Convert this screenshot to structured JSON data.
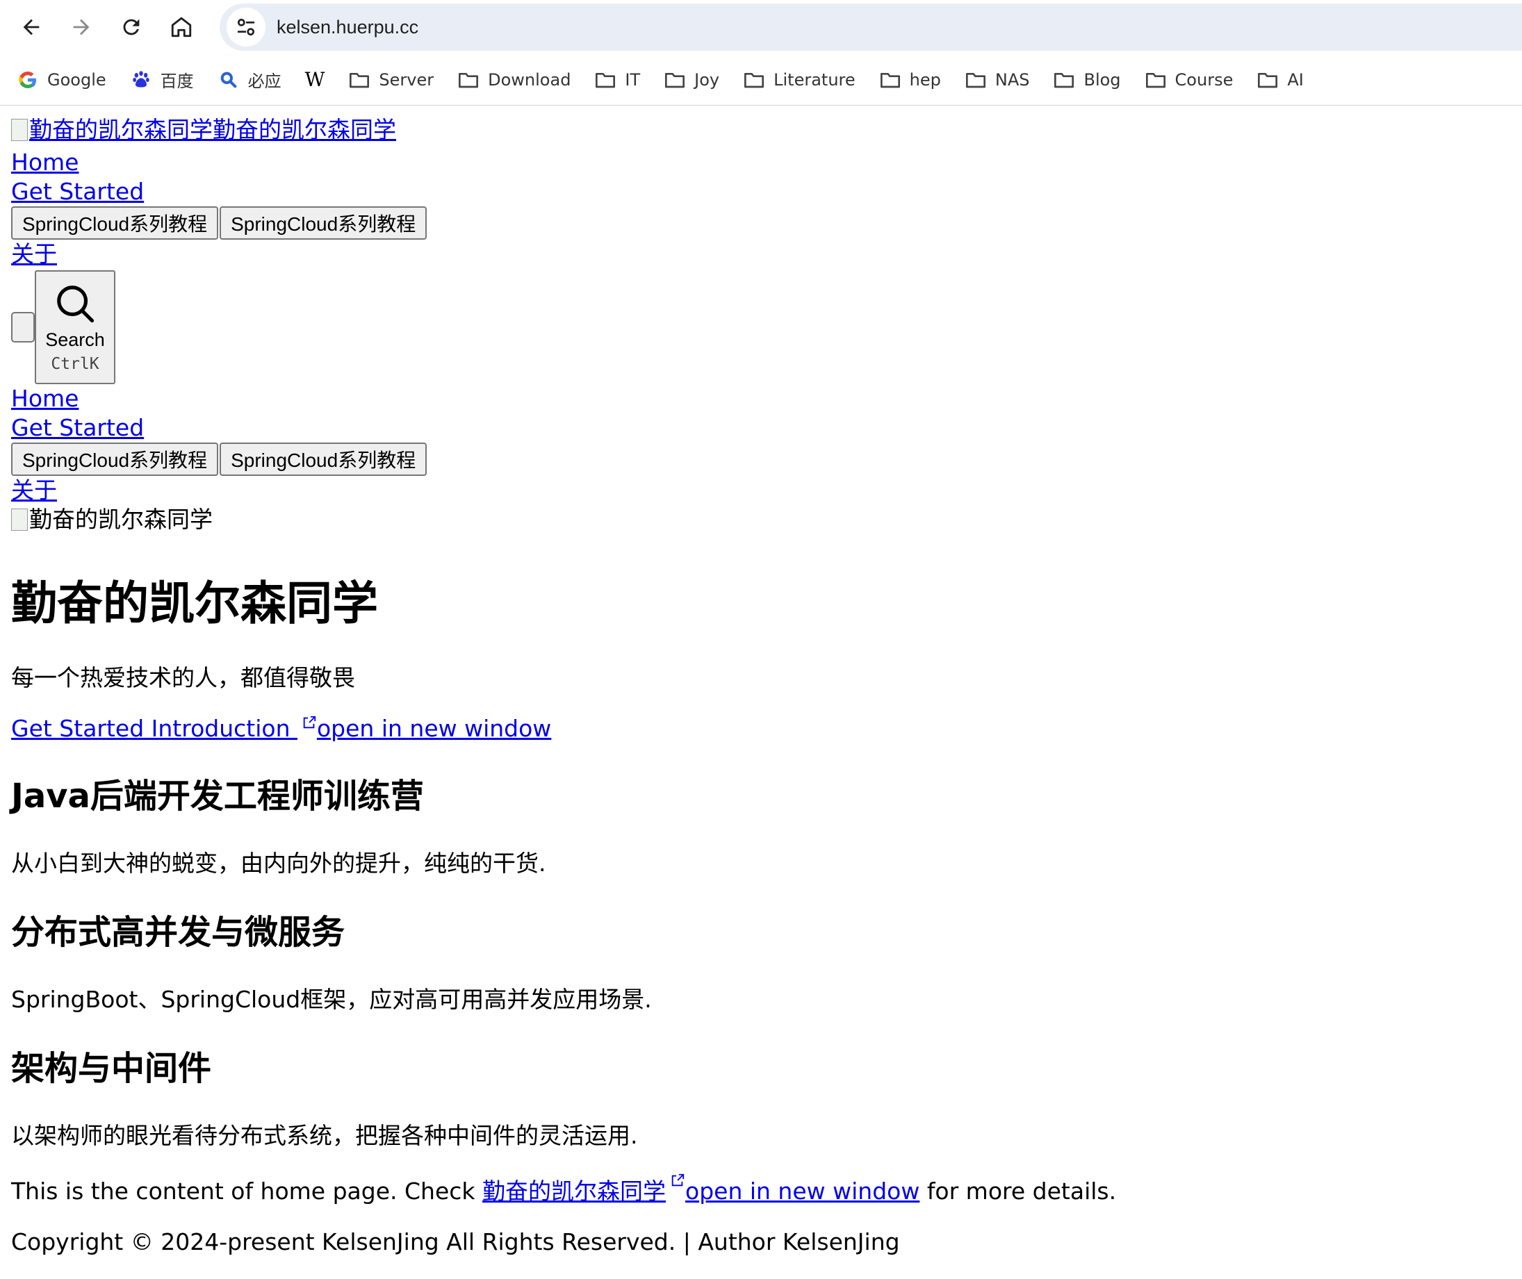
{
  "browser": {
    "url": "kelsen.huerpu.cc",
    "bookmarks": [
      "Google",
      "百度",
      "必应",
      "W",
      "Server",
      "Download",
      "IT",
      "Joy",
      "Literature",
      "hep",
      "NAS",
      "Blog",
      "Course",
      "AI"
    ]
  },
  "header": {
    "logo_alt": "勤奋的凯尔森同学",
    "site_name": "勤奋的凯尔森同学",
    "nav": {
      "home": "Home",
      "get_started": "Get Started",
      "dropdown_1": "SpringCloud系列教程",
      "dropdown_2": "SpringCloud系列教程",
      "about": "关于"
    },
    "search": {
      "label": "Search",
      "shortcut": "CtrlK"
    }
  },
  "sidebar_nav": {
    "home": "Home",
    "get_started": "Get Started",
    "dropdown_1": "SpringCloud系列教程",
    "dropdown_2": "SpringCloud系列教程",
    "about": "关于"
  },
  "hero": {
    "image_alt": "勤奋的凯尔森同学",
    "title": "勤奋的凯尔森同学",
    "tagline": "每一个热爱技术的人，都值得敬畏",
    "action_link": "Get Started Introduction ",
    "external_hint": "open in new window"
  },
  "features": [
    {
      "title": "Java后端开发工程师训练营",
      "details": "从小白到大神的蜕变，由内向外的提升，纯纯的干货."
    },
    {
      "title": "分布式高并发与微服务",
      "details": "SpringBoot、SpringCloud框架，应对高可用高并发应用场景."
    },
    {
      "title": "架构与中间件",
      "details": "以架构师的眼光看待分布式系统，把握各种中间件的灵活运用."
    }
  ],
  "footer_note": {
    "prefix": "This is the content of home page. Check ",
    "link": "勤奋的凯尔森同学",
    "external_hint": "open in new window",
    "suffix": " for more details."
  },
  "copyright": "Copyright © 2024-present KelsenJing All Rights Reserved. | Author KelsenJing"
}
